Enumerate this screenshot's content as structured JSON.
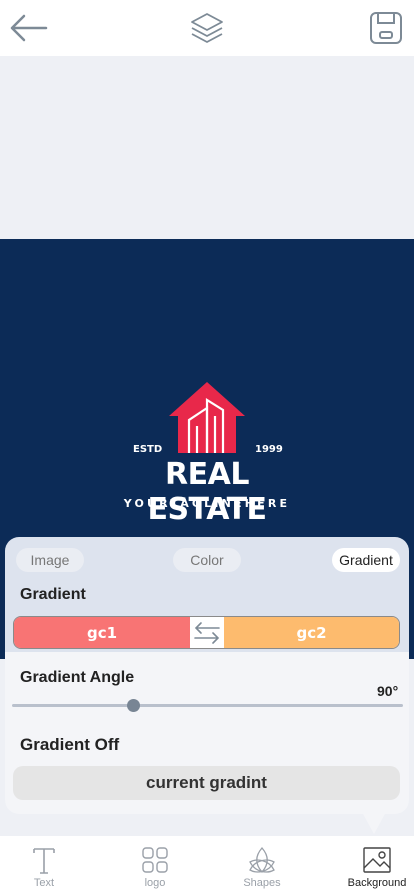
{
  "topbar": {
    "back_icon": "arrow-left-icon",
    "layers_icon": "layers-icon",
    "save_icon": "floppy-save-icon"
  },
  "design": {
    "background": "#0c2b57",
    "accent": "#e8284a",
    "estd": "ESTD",
    "year": "1999",
    "brand": "REAL ESTATE",
    "tagline": "YOURTAGLINEHERE"
  },
  "panel": {
    "tabs": [
      {
        "label": "Image"
      },
      {
        "label": "Color"
      },
      {
        "label": "Gradient"
      }
    ],
    "gradient_label": "Gradient",
    "gc1_label": "gc1",
    "gc1_color": "#f87474",
    "gc2_label": "gc2",
    "gc2_color": "#fdbb6e",
    "angle_label": "Gradient Angle",
    "angle_value": "90°",
    "angle_fraction": 0.31,
    "off_label": "Gradient Off",
    "current_button": "current gradint"
  },
  "bottomnav": {
    "items": [
      {
        "label": "Text",
        "icon": "text-icon"
      },
      {
        "label": "logo",
        "icon": "grid-icon"
      },
      {
        "label": "Shapes",
        "icon": "shapes-icon"
      },
      {
        "label": "Background",
        "icon": "image-icon"
      }
    ]
  }
}
